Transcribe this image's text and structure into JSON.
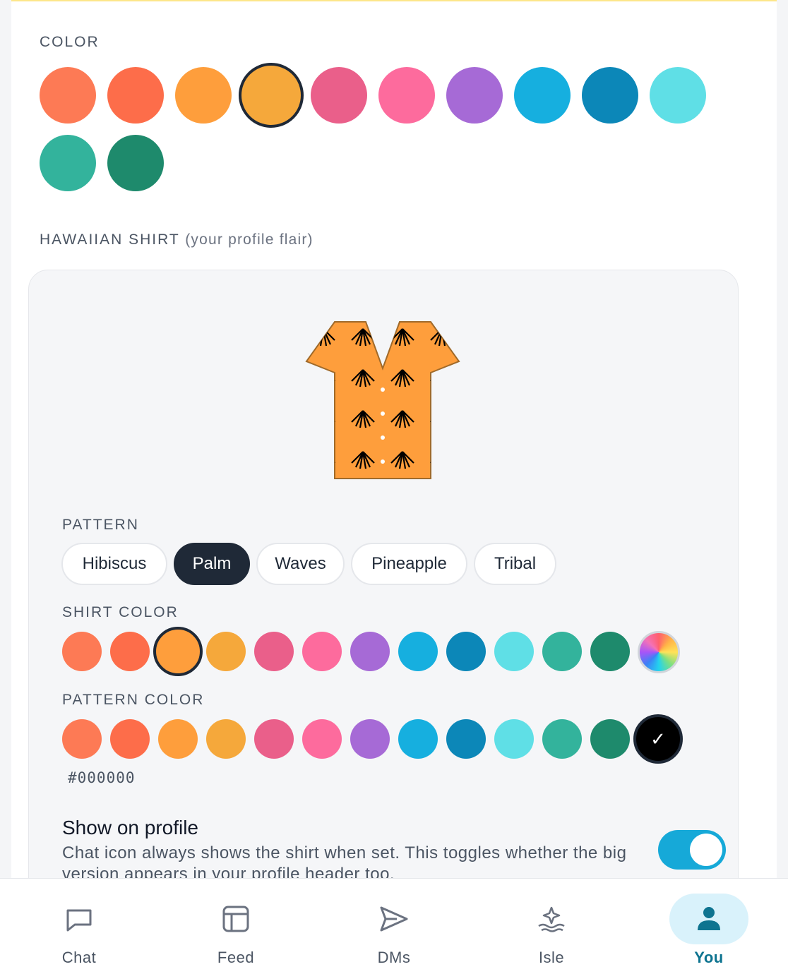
{
  "color_section": {
    "label": "COLOR",
    "swatches": [
      "#fd7a55",
      "#fd6d4a",
      "#fe9e3c",
      "#f5a83b",
      "#ea5f8a",
      "#fd6b9d",
      "#a66ad6",
      "#16afdf",
      "#0c87b8",
      "#5fdfe6",
      "#33b39c",
      "#1e8a6c"
    ],
    "selected": "#f5a83b"
  },
  "shirt_section": {
    "label": "HAWAIIAN SHIRT",
    "sublabel": "(your profile flair)",
    "preview": {
      "shirt_color": "#fe9e3c",
      "pattern_color": "#000000",
      "pattern": "Palm"
    }
  },
  "pattern": {
    "label": "PATTERN",
    "options": [
      "Hibiscus",
      "Palm",
      "Waves",
      "Pineapple",
      "Tribal"
    ],
    "selected": "Palm"
  },
  "shirt_color": {
    "label": "SHIRT COLOR",
    "swatches": [
      "#fd7a55",
      "#fd6d4a",
      "#fe9e3c",
      "#f5a83b",
      "#ea5f8a",
      "#fd6b9d",
      "#a66ad6",
      "#16afdf",
      "#0c87b8",
      "#5fdfe6",
      "#33b39c",
      "#1e8a6c"
    ],
    "selected": "#fe9e3c",
    "custom_icon": "color-wheel-icon"
  },
  "pattern_color": {
    "label": "PATTERN COLOR",
    "swatches": [
      "#fd7a55",
      "#fd6d4a",
      "#fe9e3c",
      "#f5a83b",
      "#ea5f8a",
      "#fd6b9d",
      "#a66ad6",
      "#16afdf",
      "#0c87b8",
      "#5fdfe6",
      "#33b39c",
      "#1e8a6c",
      "#000000"
    ],
    "selected": "#000000",
    "check": "✓",
    "hex": "#000000"
  },
  "show_on_profile": {
    "title": "Show on profile",
    "description": "Chat icon always shows the shirt when set. This toggles whether the big version appears in your profile header too.",
    "enabled": true
  },
  "bottom_nav": {
    "items": [
      {
        "label": "Chat",
        "icon": "chat-bubble-icon"
      },
      {
        "label": "Feed",
        "icon": "feed-layout-icon"
      },
      {
        "label": "DMs",
        "icon": "send-icon"
      },
      {
        "label": "Isle",
        "icon": "island-sparkle-icon"
      },
      {
        "label": "You",
        "icon": "person-icon"
      }
    ],
    "active": "You",
    "active_color": "#0e7490"
  }
}
